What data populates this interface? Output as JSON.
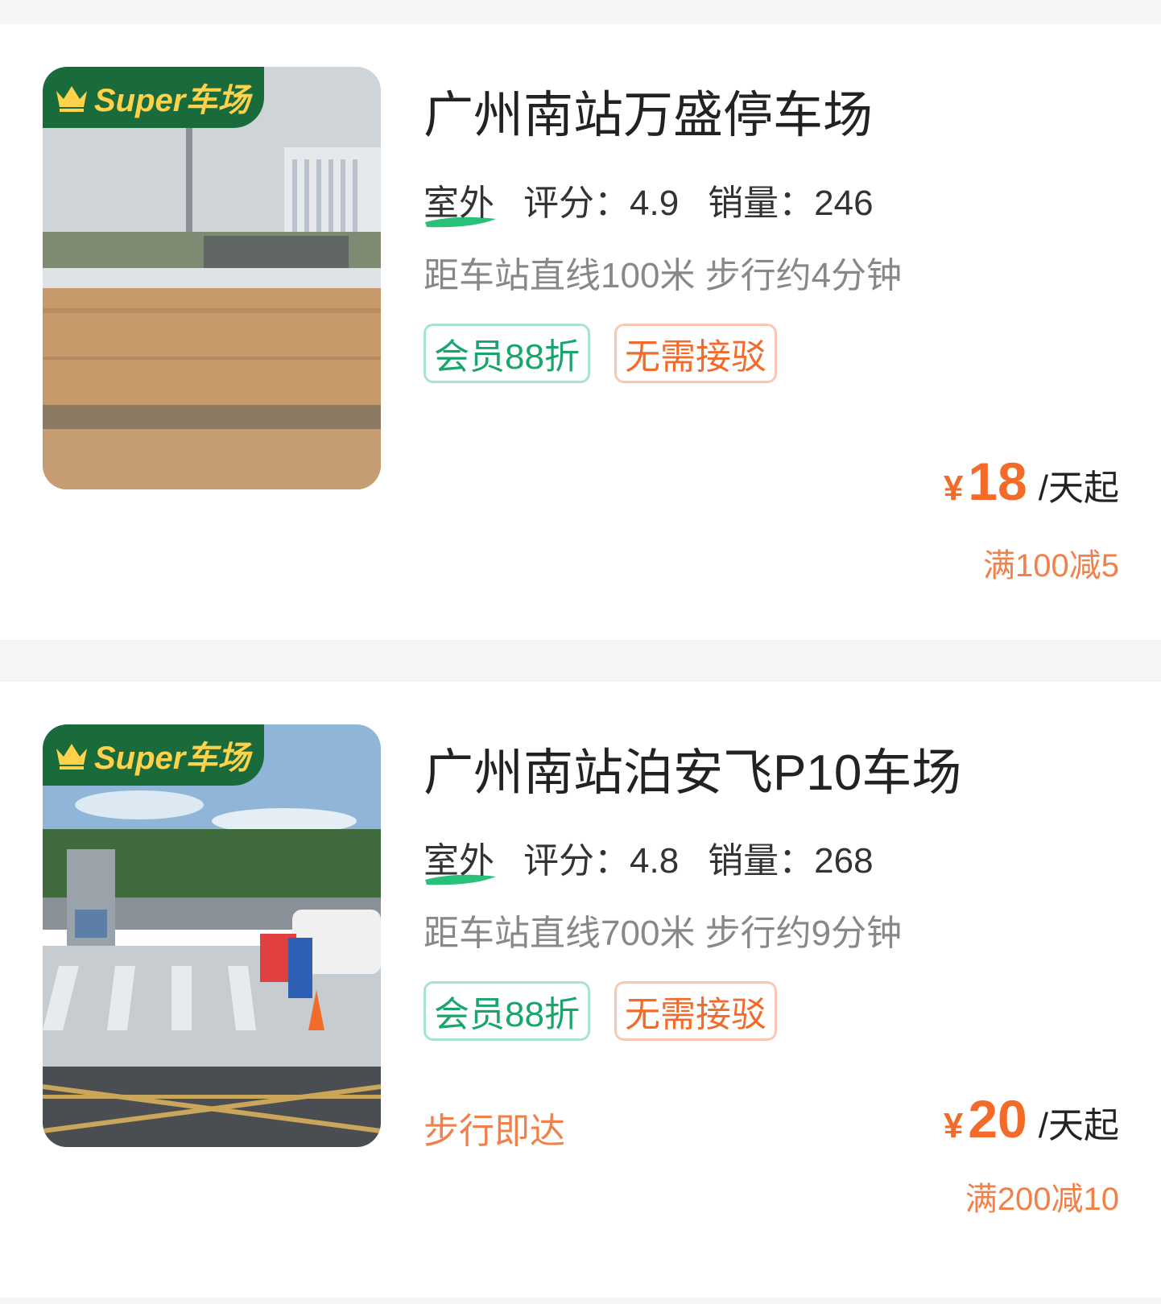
{
  "listings": [
    {
      "badge": "Super车场",
      "name": "广州南站万盛停车场",
      "type": "室外",
      "rating": "评分：4.9",
      "sales": "销量：246",
      "distance": "距车站直线100米 步行约4分钟",
      "tags": [
        "会员88折",
        "无需接驳"
      ],
      "walk_note": "",
      "currency": "¥",
      "price": "18",
      "price_unit": "/天起",
      "promo": "满100减5"
    },
    {
      "badge": "Super车场",
      "name": "广州南站泊安飞P10车场",
      "type": "室外",
      "rating": "评分：4.8",
      "sales": "销量：268",
      "distance": "距车站直线700米 步行约9分钟",
      "tags": [
        "会员88折",
        "无需接驳"
      ],
      "walk_note": "步行即达",
      "currency": "¥",
      "price": "20",
      "price_unit": "/天起",
      "promo": "满200减10"
    }
  ],
  "colors": {
    "accent_orange": "#f26b2a",
    "member_green": "#19a56b",
    "badge_green": "#1a6b3c",
    "badge_gold": "#ffd24a"
  },
  "icons": [
    "crown-icon"
  ]
}
